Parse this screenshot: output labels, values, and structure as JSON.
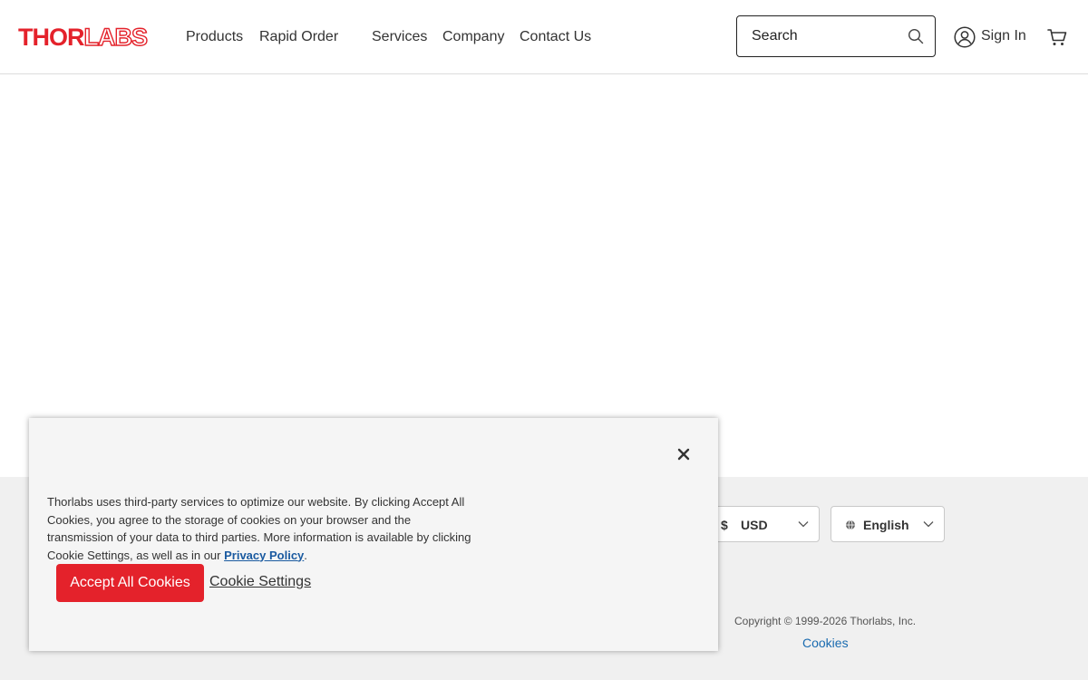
{
  "header": {
    "logo": {
      "part1": "THOR",
      "part2": "LABS"
    },
    "nav": [
      "Products",
      "Rapid Order",
      "Services",
      "Company",
      "Contact Us"
    ],
    "search": {
      "placeholder": "Search",
      "icon": "search-icon"
    },
    "sign_in": {
      "label": "Sign In",
      "icon": "user-icon"
    },
    "cart": {
      "icon": "cart-icon"
    }
  },
  "footer": {
    "currency": {
      "symbol": "$",
      "value": "USD"
    },
    "language": {
      "value": "English",
      "icon": "globe-icon"
    },
    "copyright": "Copyright © 1999-2026 Thorlabs, Inc.",
    "cookies_link": "Cookies"
  },
  "cookie_banner": {
    "text_before": "Thorlabs uses third-party services to optimize our website. By clicking Accept All Cookies, you agree to the storage of cookies on your browser and the transmission of your data to third parties. More information is available by clicking Cookie Settings, as well as in our ",
    "link_text": "Privacy Policy",
    "text_after": ".",
    "accept_label": "Accept All Cookies",
    "settings_label": "Cookie Settings",
    "close_icon": "close-icon"
  },
  "colors": {
    "brand_red": "#e4222b",
    "link_blue": "#1a6bb0"
  }
}
